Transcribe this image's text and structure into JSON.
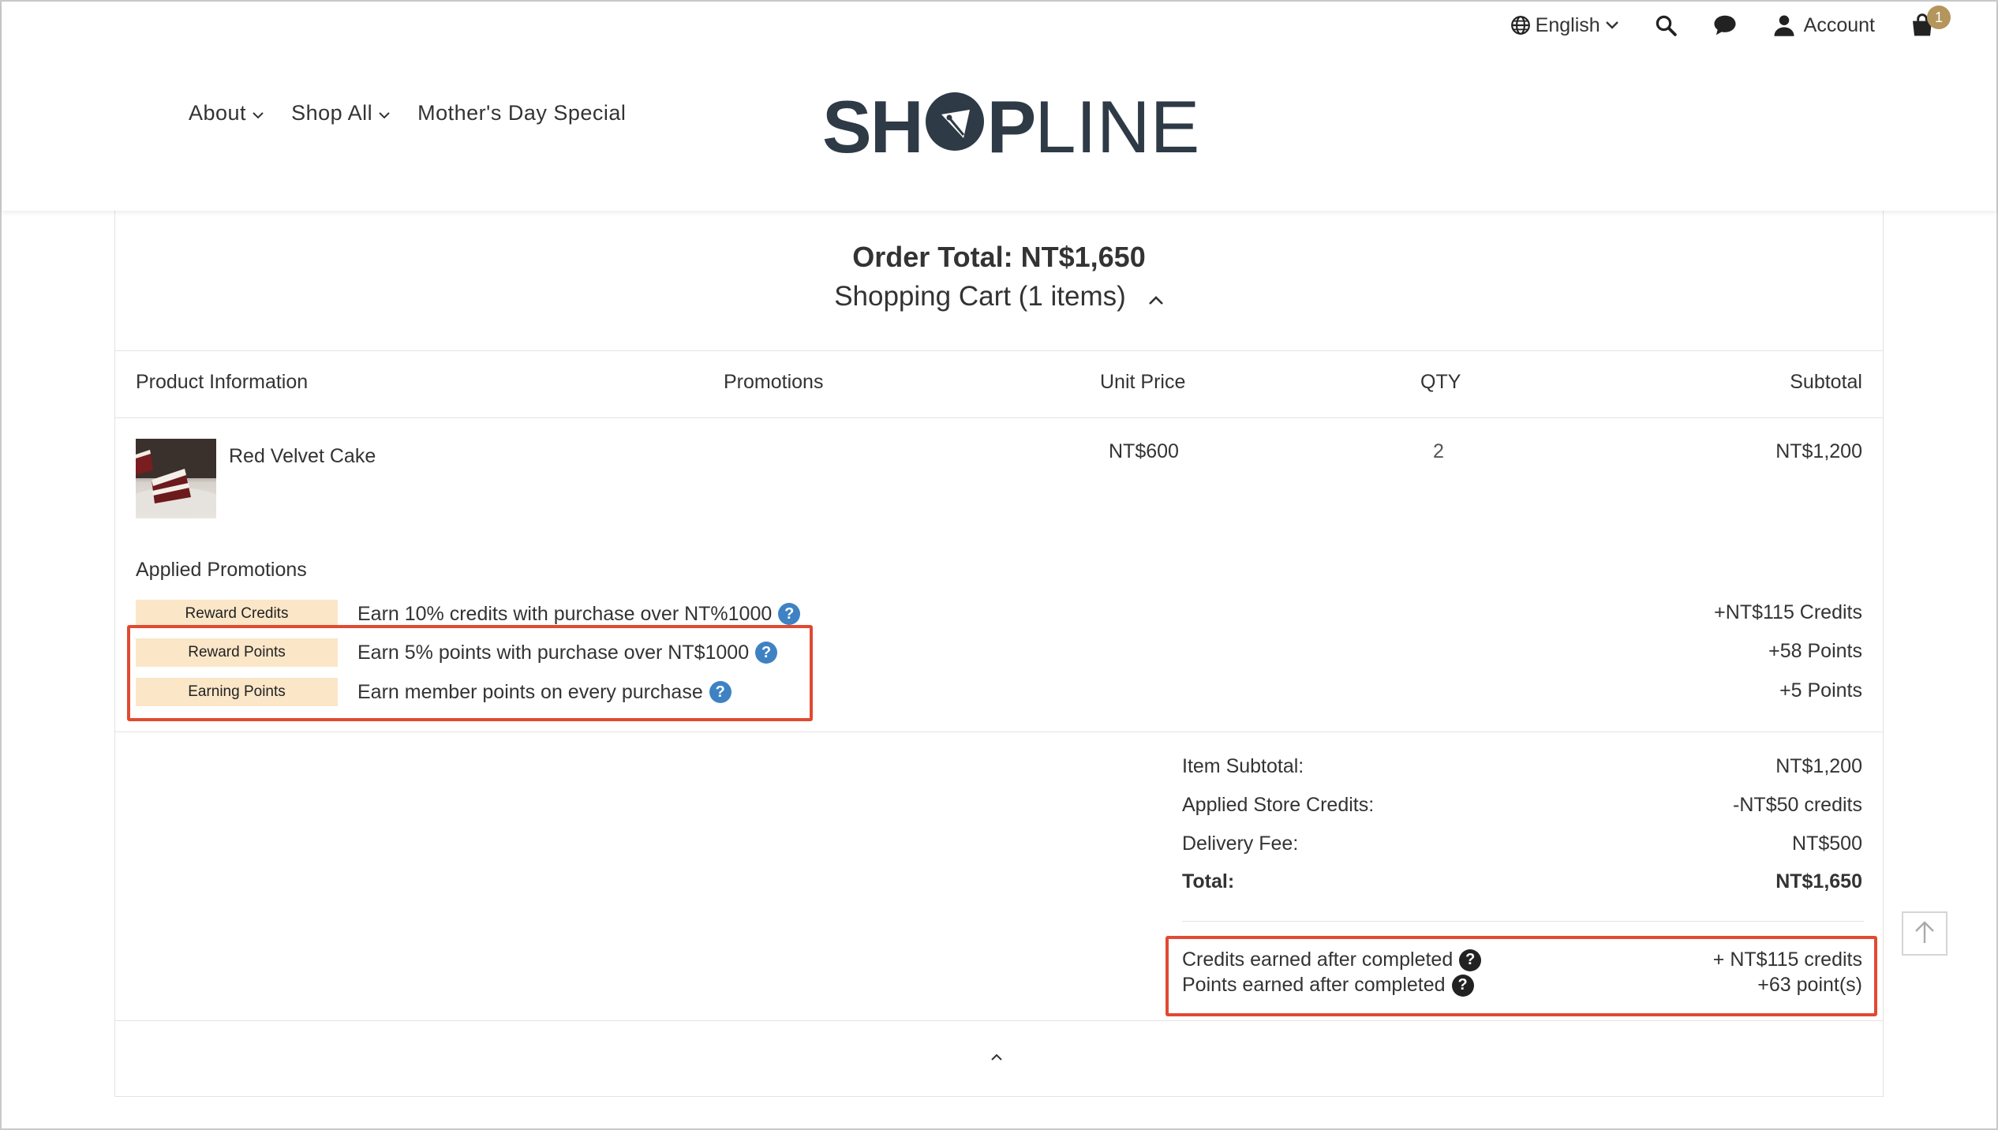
{
  "colors": {
    "accent_highlight": "#e04a32",
    "badge": "#b4955c",
    "tag_bg": "#fbe6c8",
    "help_icon": "#3e82c4",
    "logo": "#2e3a45"
  },
  "header": {
    "language": "English",
    "account_label": "Account",
    "cart_count": "1",
    "logo_bold": "SH",
    "logo_p": "P",
    "logo_light": "LINE",
    "nav": [
      {
        "label": "About",
        "icon": "chevron-down-icon"
      },
      {
        "label": "Shop All",
        "icon": "chevron-down-icon"
      },
      {
        "label": "Mother's Day Special"
      }
    ]
  },
  "order": {
    "total_line": "Order Total: NT$1,650",
    "cart_title": "Shopping Cart (1 items)"
  },
  "table": {
    "headers": [
      "Product Information",
      "Promotions",
      "Unit Price",
      "QTY",
      "Subtotal"
    ],
    "items": [
      {
        "name": "Red Velvet Cake",
        "unit_price": "NT$600",
        "qty": "2",
        "subtotal": "NT$1,200"
      }
    ]
  },
  "promotions": {
    "title": "Applied Promotions",
    "rows": [
      {
        "tag": "Reward Credits",
        "text": "Earn 10% credits with purchase over NT%1000",
        "value": "+NT$115 Credits"
      },
      {
        "tag": "Reward Points",
        "text": "Earn 5% points with purchase over NT$1000",
        "value": "+58 Points"
      },
      {
        "tag": "Earning Points",
        "text": "Earn member points on every purchase",
        "value": "+5 Points"
      }
    ]
  },
  "summary": {
    "rows": [
      {
        "label": "Item Subtotal:",
        "value": "NT$1,200"
      },
      {
        "label": "Applied Store Credits:",
        "value": "-NT$50 credits"
      },
      {
        "label": "Delivery Fee:",
        "value": "NT$500"
      },
      {
        "label": "Total:",
        "value": "NT$1,650"
      }
    ],
    "credits_earned_label": "Credits earned after completed",
    "credits_earned_value": "+ NT$115 credits",
    "points_earned_label": "Points earned after completed",
    "points_earned_value": "+63 point(s)"
  },
  "help_glyph": "?"
}
